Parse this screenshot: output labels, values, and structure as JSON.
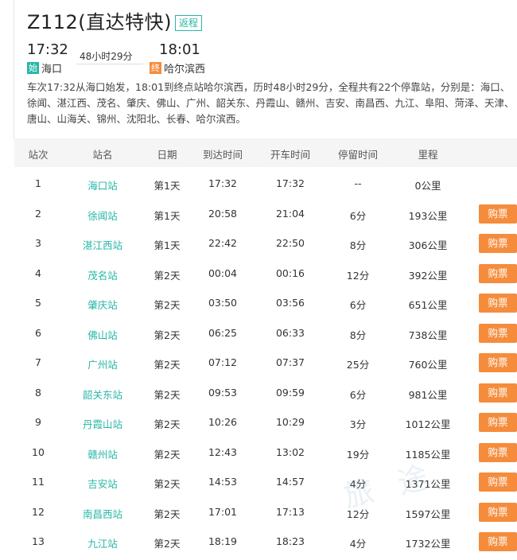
{
  "header": {
    "train_title": "Z112(直达特快)",
    "tag": "返程",
    "departure_time": "17:32",
    "arrival_time": "18:01",
    "duration": "48小时29分",
    "start_badge": "始",
    "start_station": "海口",
    "end_badge": "终",
    "end_station": "哈尔滨西",
    "summary": "车次17:32从海口始发，18:01到终点站哈尔滨西，历时48小时29分，全程共有22个停靠站，分别是：海口、徐闻、湛江西、茂名、肇庆、佛山、广州、韶关东、丹霞山、赣州、吉安、南昌西、九江、阜阳、菏泽、天津、唐山、山海关、锦州、沈阳北、长春、哈尔滨西。"
  },
  "table": {
    "columns": [
      "站次",
      "站名",
      "日期",
      "到达时间",
      "开车时间",
      "停留时间",
      "里程"
    ],
    "buy_label": "购票",
    "rows": [
      {
        "no": "1",
        "station": "海口站",
        "day": "第1天",
        "arrive": "17:32",
        "depart": "17:32",
        "stay": "--",
        "distance": "0公里",
        "buy": false
      },
      {
        "no": "2",
        "station": "徐闻站",
        "day": "第1天",
        "arrive": "20:58",
        "depart": "21:04",
        "stay": "6分",
        "distance": "193公里",
        "buy": true
      },
      {
        "no": "3",
        "station": "湛江西站",
        "day": "第1天",
        "arrive": "22:42",
        "depart": "22:50",
        "stay": "8分",
        "distance": "306公里",
        "buy": true
      },
      {
        "no": "4",
        "station": "茂名站",
        "day": "第2天",
        "arrive": "00:04",
        "depart": "00:16",
        "stay": "12分",
        "distance": "392公里",
        "buy": true
      },
      {
        "no": "5",
        "station": "肇庆站",
        "day": "第2天",
        "arrive": "03:50",
        "depart": "03:56",
        "stay": "6分",
        "distance": "651公里",
        "buy": true
      },
      {
        "no": "6",
        "station": "佛山站",
        "day": "第2天",
        "arrive": "06:25",
        "depart": "06:33",
        "stay": "8分",
        "distance": "738公里",
        "buy": true
      },
      {
        "no": "7",
        "station": "广州站",
        "day": "第2天",
        "arrive": "07:12",
        "depart": "07:37",
        "stay": "25分",
        "distance": "760公里",
        "buy": true
      },
      {
        "no": "8",
        "station": "韶关东站",
        "day": "第2天",
        "arrive": "09:53",
        "depart": "09:59",
        "stay": "6分",
        "distance": "981公里",
        "buy": true
      },
      {
        "no": "9",
        "station": "丹霞山站",
        "day": "第2天",
        "arrive": "10:26",
        "depart": "10:29",
        "stay": "3分",
        "distance": "1012公里",
        "buy": true
      },
      {
        "no": "10",
        "station": "赣州站",
        "day": "第2天",
        "arrive": "12:43",
        "depart": "13:02",
        "stay": "19分",
        "distance": "1185公里",
        "buy": true
      },
      {
        "no": "11",
        "station": "吉安站",
        "day": "第2天",
        "arrive": "14:53",
        "depart": "14:57",
        "stay": "4分",
        "distance": "1371公里",
        "buy": true
      },
      {
        "no": "12",
        "station": "南昌西站",
        "day": "第2天",
        "arrive": "17:01",
        "depart": "17:13",
        "stay": "12分",
        "distance": "1597公里",
        "buy": true
      },
      {
        "no": "13",
        "station": "九江站",
        "day": "第2天",
        "arrive": "18:19",
        "depart": "18:23",
        "stay": "4分",
        "distance": "1732公里",
        "buy": true
      }
    ]
  },
  "colors": {
    "accent": "#26b7a6",
    "button": "#f58c3c"
  }
}
